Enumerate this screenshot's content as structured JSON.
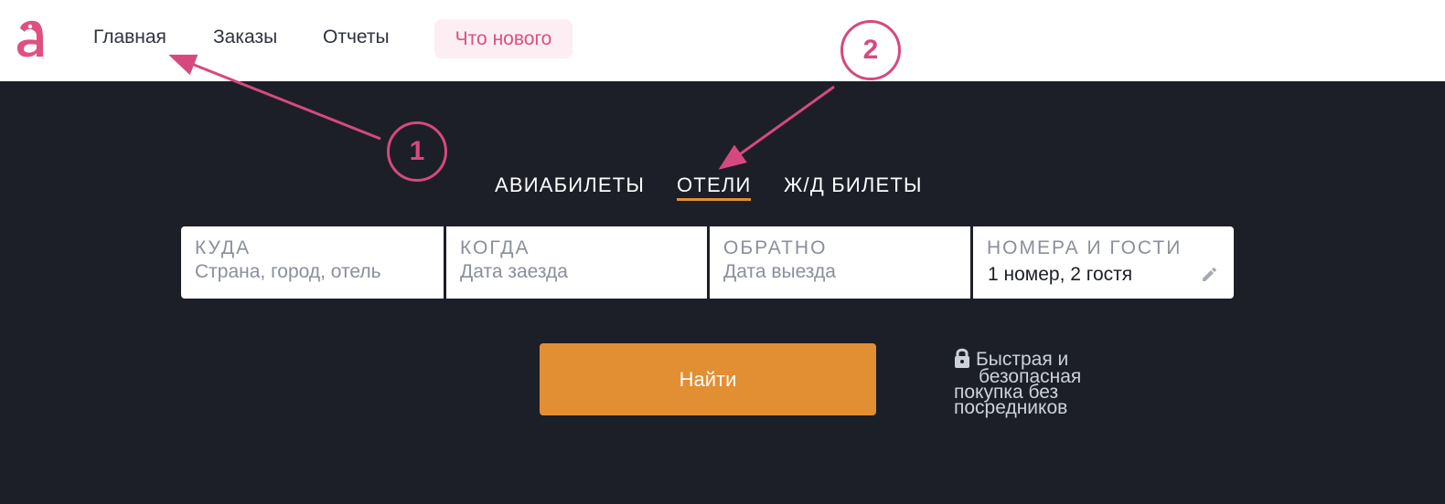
{
  "nav": {
    "home": "Главная",
    "orders": "Заказы",
    "reports": "Отчеты",
    "whats_new": "Что нового"
  },
  "tabs": {
    "flights": "АВИАБИЛЕТЫ",
    "hotels": "ОТЕЛИ",
    "rail": "Ж/Д БИЛЕТЫ",
    "active": "ОТЕЛИ"
  },
  "form": {
    "where": {
      "label": "КУДА",
      "placeholder": "Страна, город, отель"
    },
    "when": {
      "label": "КОГДА",
      "placeholder": "Дата заезда"
    },
    "back": {
      "label": "ОБРАТНО",
      "placeholder": "Дата выезда"
    },
    "guests": {
      "label": "НОМЕРА И ГОСТИ",
      "value": "1 номер, 2 гостя"
    }
  },
  "search_button": "Найти",
  "secure_note": "Быстрая и безопасная покупка без посредников",
  "secure_note_lines": [
    "Быстрая и",
    "безопасная",
    "покупка без",
    "посредников"
  ],
  "annotations": {
    "marker1": "1",
    "marker2": "2"
  },
  "colors": {
    "brand": "#e0507e",
    "hero_bg": "#1c1f28",
    "accent": "#e28e32",
    "annotation": "#d6497f"
  },
  "icons": {
    "logo": "brand-a-logo",
    "edit": "pencil-icon",
    "secure": "lock-icon"
  }
}
